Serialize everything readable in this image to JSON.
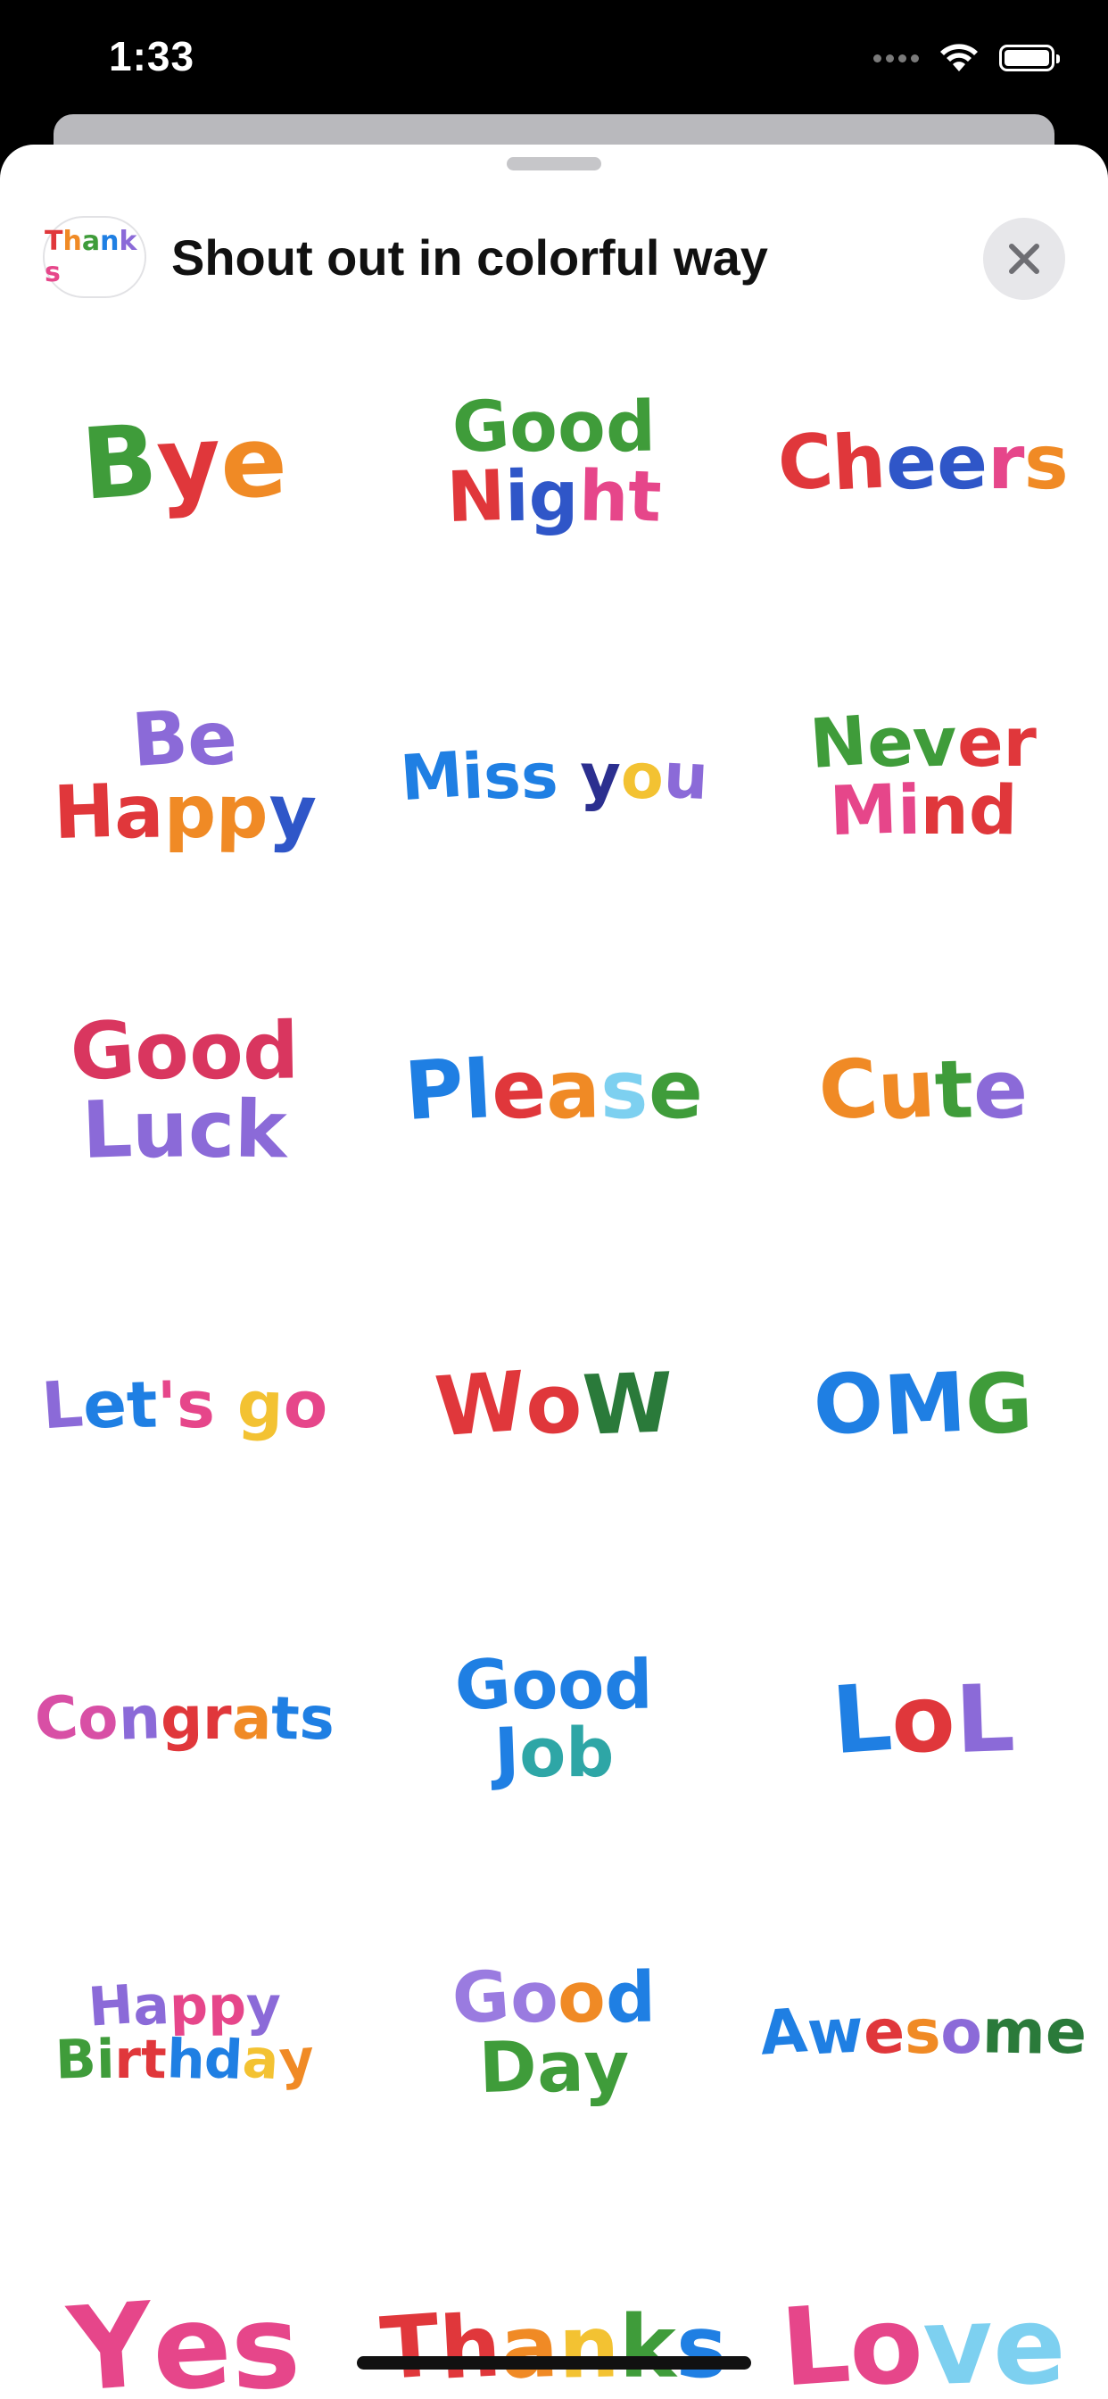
{
  "status_bar": {
    "time": "1:33"
  },
  "header": {
    "title": "Shout out in colorful way",
    "icon_text": "Thanks"
  },
  "stickers": [
    {
      "label": "Bye",
      "lines": [
        [
          [
            "B",
            "#3f9c3a"
          ],
          [
            "y",
            "#e0373b"
          ],
          [
            "e",
            "#f08a25"
          ]
        ]
      ],
      "size": 110
    },
    {
      "label": "Good Night",
      "lines": [
        [
          [
            "G",
            "#3f9c3a"
          ],
          [
            "o",
            "#3f9c3a"
          ],
          [
            "o",
            "#3f9c3a"
          ],
          [
            "d",
            "#3f9c3a"
          ]
        ],
        [
          [
            "N",
            "#e0373b"
          ],
          [
            "i",
            "#2f56c8"
          ],
          [
            "g",
            "#2f56c8"
          ],
          [
            "h",
            "#e6468a"
          ],
          [
            "t",
            "#e6468a"
          ]
        ]
      ],
      "size": 78
    },
    {
      "label": "Cheers",
      "lines": [
        [
          [
            "C",
            "#e0373b"
          ],
          [
            "h",
            "#e0373b"
          ],
          [
            "e",
            "#2f56c8"
          ],
          [
            "e",
            "#2f56c8"
          ],
          [
            "r",
            "#e6468a"
          ],
          [
            "s",
            "#f08a25"
          ]
        ]
      ],
      "size": 84
    },
    {
      "label": "Be Happy",
      "lines": [
        [
          [
            "B",
            "#8b6ad8"
          ],
          [
            "e",
            "#8b6ad8"
          ]
        ],
        [
          [
            "H",
            "#e0373b"
          ],
          [
            "a",
            "#e0373b"
          ],
          [
            "p",
            "#f08a25"
          ],
          [
            "p",
            "#f08a25"
          ],
          [
            "y",
            "#2f56c8"
          ]
        ]
      ],
      "size": 82
    },
    {
      "label": "Miss you",
      "lines": [
        [
          [
            "M",
            "#1f7fe3"
          ],
          [
            "i",
            "#1f7fe3"
          ],
          [
            "s",
            "#1f7fe3"
          ],
          [
            "s",
            "#1f7fe3"
          ],
          [
            " ",
            "#000"
          ],
          [
            "y",
            "#2b2f8f"
          ],
          [
            "o",
            "#f3c232"
          ],
          [
            "u",
            "#8b6ad8"
          ]
        ]
      ],
      "size": 70
    },
    {
      "label": "Never Mind",
      "lines": [
        [
          [
            "N",
            "#3f9c3a"
          ],
          [
            "e",
            "#3f9c3a"
          ],
          [
            "v",
            "#3f9c3a"
          ],
          [
            "e",
            "#e0373b"
          ],
          [
            "r",
            "#e0373b"
          ]
        ],
        [
          [
            "M",
            "#e6468a"
          ],
          [
            "i",
            "#e6468a"
          ],
          [
            "n",
            "#e0373b"
          ],
          [
            "d",
            "#e0373b"
          ]
        ]
      ],
      "size": 76
    },
    {
      "label": "Good Luck",
      "lines": [
        [
          [
            "G",
            "#d9365f"
          ],
          [
            "o",
            "#d9365f"
          ],
          [
            "o",
            "#d9365f"
          ],
          [
            "d",
            "#d9365f"
          ]
        ],
        [
          [
            "L",
            "#8b6ad8"
          ],
          [
            "u",
            "#8b6ad8"
          ],
          [
            "c",
            "#8b6ad8"
          ],
          [
            "k",
            "#8b6ad8"
          ]
        ]
      ],
      "size": 88
    },
    {
      "label": "Please",
      "lines": [
        [
          [
            "P",
            "#1f7fe3"
          ],
          [
            "l",
            "#1f7fe3"
          ],
          [
            "e",
            "#e0373b"
          ],
          [
            "a",
            "#f08a25"
          ],
          [
            "s",
            "#7dd0f0"
          ],
          [
            "e",
            "#3f9c3a"
          ]
        ]
      ],
      "size": 90
    },
    {
      "label": "Cute",
      "lines": [
        [
          [
            "C",
            "#f08a25"
          ],
          [
            "u",
            "#f08a25"
          ],
          [
            "t",
            "#3f9c3a"
          ],
          [
            "e",
            "#8b6ad8"
          ]
        ]
      ],
      "size": 90
    },
    {
      "label": "Let's go",
      "lines": [
        [
          [
            "L",
            "#8b6ad8"
          ],
          [
            "e",
            "#1f7fe3"
          ],
          [
            "t",
            "#1f7fe3"
          ],
          [
            "'",
            "#e6468a"
          ],
          [
            "s",
            "#e6468a"
          ],
          [
            " ",
            "#000"
          ],
          [
            "g",
            "#f3c232"
          ],
          [
            "o",
            "#e6468a"
          ]
        ]
      ],
      "size": 72
    },
    {
      "label": "WoW",
      "lines": [
        [
          [
            "W",
            "#e0373b"
          ],
          [
            "o",
            "#e0373b"
          ],
          [
            "W",
            "#2a7a3a"
          ]
        ]
      ],
      "size": 92
    },
    {
      "label": "OMG",
      "lines": [
        [
          [
            "O",
            "#1f7fe3"
          ],
          [
            "M",
            "#1f7fe3"
          ],
          [
            "G",
            "#3f9c3a"
          ]
        ]
      ],
      "size": 92
    },
    {
      "label": "Congrats",
      "lines": [
        [
          [
            "C",
            "#d84fa5"
          ],
          [
            "o",
            "#d84fa5"
          ],
          [
            "n",
            "#8b6ad8"
          ],
          [
            "g",
            "#e0373b"
          ],
          [
            "r",
            "#e0373b"
          ],
          [
            "a",
            "#f08a25"
          ],
          [
            "t",
            "#1f7fe3"
          ],
          [
            "s",
            "#1f7fe3"
          ]
        ]
      ],
      "size": 66
    },
    {
      "label": "Good Job",
      "lines": [
        [
          [
            "G",
            "#1f7fe3"
          ],
          [
            "o",
            "#1f7fe3"
          ],
          [
            "o",
            "#1f7fe3"
          ],
          [
            "d",
            "#1f7fe3"
          ]
        ],
        [
          [
            "J",
            "#1f7fe3"
          ],
          [
            "o",
            "#2ea6a6"
          ],
          [
            "b",
            "#2ea6a6"
          ]
        ]
      ],
      "size": 76
    },
    {
      "label": "LoL",
      "lines": [
        [
          [
            "L",
            "#1f7fe3"
          ],
          [
            "o",
            "#e0373b"
          ],
          [
            "L",
            "#8b6ad8"
          ]
        ]
      ],
      "size": 104
    },
    {
      "label": "Happy Birthday",
      "lines": [
        [
          [
            "H",
            "#8b6ad8"
          ],
          [
            "a",
            "#8b6ad8"
          ],
          [
            "p",
            "#e6468a"
          ],
          [
            "p",
            "#e6468a"
          ],
          [
            "y",
            "#8b6ad8"
          ]
        ],
        [
          [
            "B",
            "#3f9c3a"
          ],
          [
            "i",
            "#3f9c3a"
          ],
          [
            "r",
            "#e0373b"
          ],
          [
            "t",
            "#e0373b"
          ],
          [
            "h",
            "#1f7fe3"
          ],
          [
            "d",
            "#1f7fe3"
          ],
          [
            "a",
            "#f3c232"
          ],
          [
            "y",
            "#f08a25"
          ]
        ]
      ],
      "size": 60
    },
    {
      "label": "Good Day",
      "lines": [
        [
          [
            "G",
            "#9a7be0"
          ],
          [
            "o",
            "#9a7be0"
          ],
          [
            "o",
            "#f08a25"
          ],
          [
            "d",
            "#1f7fe3"
          ]
        ],
        [
          [
            "D",
            "#3f9c3a"
          ],
          [
            "a",
            "#3f9c3a"
          ],
          [
            "y",
            "#3f9c3a"
          ]
        ]
      ],
      "size": 78
    },
    {
      "label": "Awesome",
      "lines": [
        [
          [
            "A",
            "#1f7fe3"
          ],
          [
            "w",
            "#1f7fe3"
          ],
          [
            "e",
            "#e0373b"
          ],
          [
            "s",
            "#f08a25"
          ],
          [
            "o",
            "#8b6ad8"
          ],
          [
            "m",
            "#2a7a3a"
          ],
          [
            "e",
            "#2a7a3a"
          ]
        ]
      ],
      "size": 68
    },
    {
      "label": "Yes",
      "lines": [
        [
          [
            "Y",
            "#e6468a"
          ],
          [
            "e",
            "#e6468a"
          ],
          [
            "s",
            "#e6468a"
          ]
        ]
      ],
      "size": 130
    },
    {
      "label": "Thanks",
      "lines": [
        [
          [
            "T",
            "#e0373b"
          ],
          [
            "h",
            "#e0373b"
          ],
          [
            "a",
            "#f08a25"
          ],
          [
            "n",
            "#f3c232"
          ],
          [
            "k",
            "#3f9c3a"
          ],
          [
            "s",
            "#1f7fe3"
          ]
        ]
      ],
      "size": 96
    },
    {
      "label": "Love",
      "lines": [
        [
          [
            "L",
            "#e6468a"
          ],
          [
            "o",
            "#e6468a"
          ],
          [
            "v",
            "#7dd0f0"
          ],
          [
            "e",
            "#7dd0f0"
          ]
        ]
      ],
      "size": 120
    }
  ]
}
